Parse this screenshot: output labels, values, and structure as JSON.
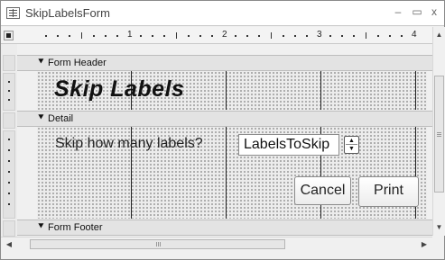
{
  "window": {
    "title": "SkipLabelsForm",
    "controls": {
      "minimize": "–",
      "maximize": "▭",
      "close": "x"
    }
  },
  "ruler": {
    "marks": [
      "1",
      "2",
      "3",
      "4"
    ]
  },
  "sections": {
    "form_header": {
      "label": "Form Header",
      "arrow": "🢓"
    },
    "detail": {
      "label": "Detail",
      "arrow": "🢓"
    },
    "form_footer": {
      "label": "Form Footer",
      "arrow": "🢓"
    }
  },
  "header": {
    "title": "Skip Labels"
  },
  "detail": {
    "prompt_label": "Skip how many labels?",
    "input_value": "LabelsToSkip",
    "spin_up": "▲",
    "spin_down": "▼",
    "cancel_label": "Cancel",
    "print_label": "Print"
  },
  "icons": {
    "form_icon": "form-icon",
    "section_arrow": "down-arrow-icon",
    "scroll_up": "▲",
    "scroll_down": "▼",
    "scroll_left": "◀",
    "scroll_right": "▶"
  }
}
